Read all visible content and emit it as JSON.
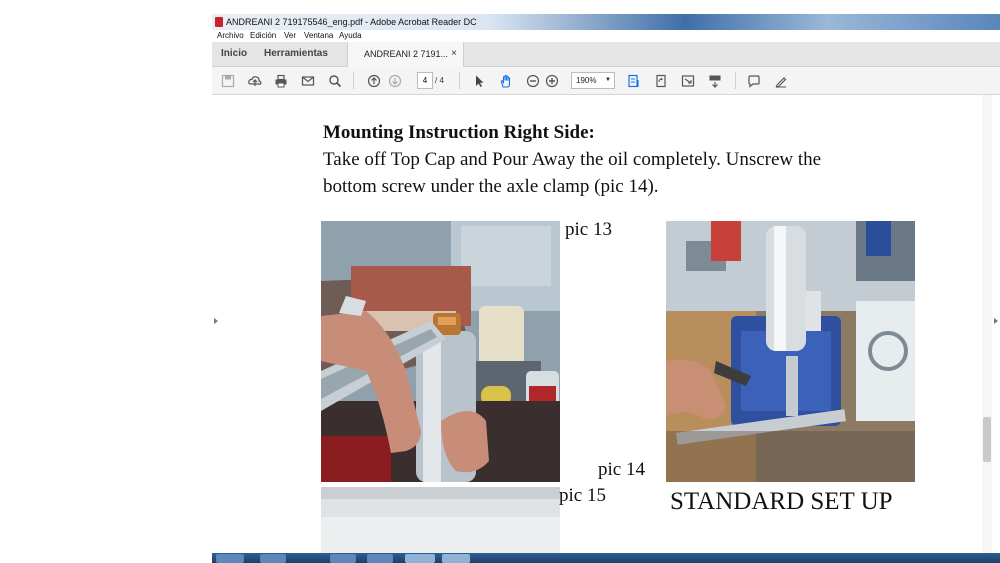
{
  "window": {
    "title": "ANDREANI 2 719175546_eng.pdf - Adobe Acrobat Reader DC"
  },
  "menu": [
    "Archivo",
    "Edición",
    "Ver",
    "Ventana",
    "Ayuda"
  ],
  "tabs": {
    "home": "Inicio",
    "tools": "Herramientas",
    "document": "ANDREANI 2 7191...",
    "close": "×"
  },
  "toolbar": {
    "page_current": "4",
    "page_total": "/ 4",
    "zoom": "190%",
    "zoom_caret": "▼"
  },
  "colors": {
    "accent": "#1473e6",
    "title_gradient": "#3f6fa8",
    "taskbar": "#2d5f93"
  },
  "document": {
    "heading": "Mounting Instruction Right Side:",
    "line1": "Take off Top Cap and Pour Away the oil completely. Unscrew the",
    "line2": "bottom screw under the axle clamp (pic 14).",
    "captions": {
      "pic13": "pic 13",
      "pic14": "pic 14",
      "pic15": "pic 15",
      "setup": "STANDARD SET UP"
    }
  },
  "scroll": {
    "position_fraction": 0.78
  }
}
